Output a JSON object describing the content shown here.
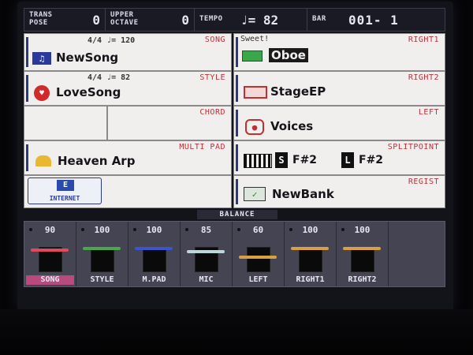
{
  "topbar": {
    "transpose_label_1": "TRANS",
    "transpose_label_2": "POSE",
    "transpose_value": "0",
    "octave_label_1": "UPPER",
    "octave_label_2": "OCTAVE",
    "octave_value": "0",
    "tempo_label": "TEMPO",
    "tempo_value": "♩= 82",
    "bar_label": "BAR",
    "bar_value": "001- 1"
  },
  "song": {
    "corner": "SONG",
    "meta": "4/4  ♩= 120",
    "name": "NewSong"
  },
  "style": {
    "corner": "STYLE",
    "meta": "4/4  ♩= 82",
    "name": "LoveSong"
  },
  "chord": {
    "corner": "CHORD"
  },
  "multipad": {
    "corner": "MULTI PAD",
    "name": "Heaven Arp"
  },
  "internet": {
    "label": "INTERNET"
  },
  "right1": {
    "corner": "RIGHT1",
    "sub": "Sweet!",
    "name": "Oboe"
  },
  "right2": {
    "corner": "RIGHT2",
    "name": "StageEP"
  },
  "left": {
    "corner": "LEFT",
    "name": "Voices"
  },
  "split": {
    "corner": "SPLITPOINT",
    "s_key": "F#2",
    "l_key": "F#2",
    "s_tag": "S",
    "l_tag": "L"
  },
  "regist": {
    "corner": "REGIST",
    "name": "NewBank"
  },
  "balance": {
    "title": "BALANCE",
    "channels": [
      {
        "volume": "90",
        "label": "SONG",
        "fader_color": "#e04a5a",
        "level": 90
      },
      {
        "volume": "100",
        "label": "STYLE",
        "fader_color": "#4aa84a",
        "level": 100
      },
      {
        "volume": "100",
        "label": "M.PAD",
        "fader_color": "#3a55d0",
        "level": 100
      },
      {
        "volume": "85",
        "label": "MIC",
        "fader_color": "#b8d8dc",
        "level": 85
      },
      {
        "volume": "60",
        "label": "LEFT",
        "fader_color": "#d8a040",
        "level": 60
      },
      {
        "volume": "100",
        "label": "RIGHT1",
        "fader_color": "#d8a040",
        "level": 100
      },
      {
        "volume": "100",
        "label": "RIGHT2",
        "fader_color": "#d8a040",
        "level": 100
      }
    ]
  }
}
